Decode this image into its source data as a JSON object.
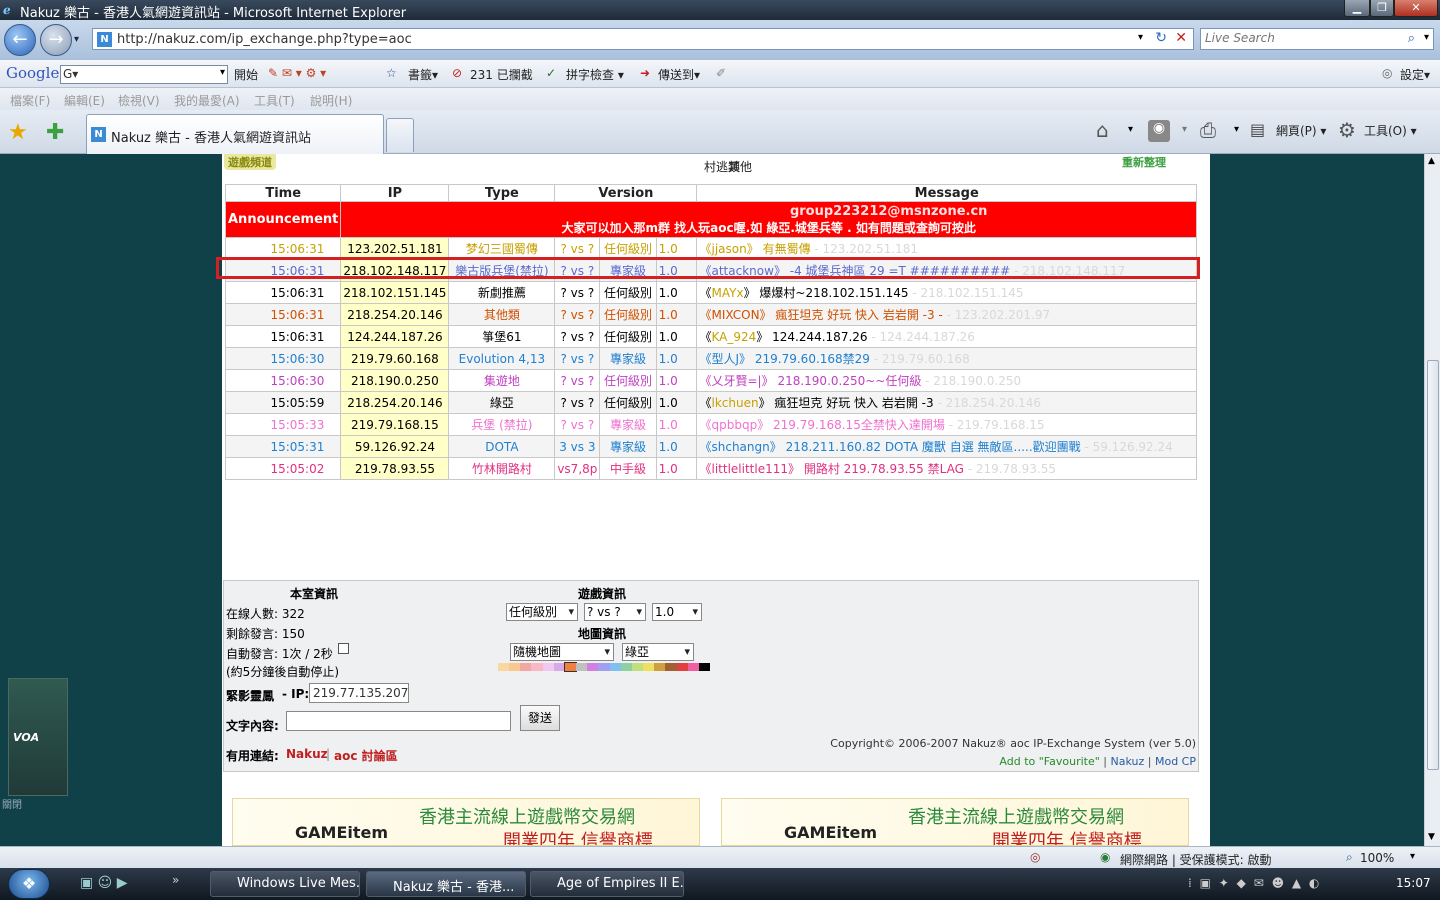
{
  "window": {
    "title": "Nakuz 樂古 - 香港人氣網遊資訊站 - Microsoft Internet Explorer"
  },
  "address": {
    "url": "http://nakuz.com/ip_exchange.php?type=aoc",
    "search_placeholder": "Live Search"
  },
  "googlebar": {
    "logo": "Google",
    "search_value": "G▾",
    "items": [
      "開始",
      "書籤▾",
      "231 已攔截",
      "拼字檢查 ▾",
      "傳送到▾"
    ],
    "settings": "設定▾"
  },
  "menu": [
    "檔案(F)",
    "編輯(E)",
    "檢視(V)",
    "我的最愛(A)",
    "工具(T)",
    "說明(H)"
  ],
  "tabs": {
    "active": "Nakuz 樂古 - 香港人氣網遊資訊站",
    "command": [
      "網頁(P) ▾",
      "工具(O) ▾"
    ]
  },
  "page": {
    "corner_left": "遊戲頻道",
    "corner_right": "重新整理",
    "categories": [
      "村逃類",
      "其他"
    ],
    "table": {
      "headers": [
        "Time",
        "IP",
        "Type",
        "Version",
        "Message"
      ],
      "announcement": {
        "label": "Announcement",
        "email": "group223212@msnzone.cn",
        "text": "大家可以加入那m群 找人玩aoc喔.如 綠亞.城堡兵等 . 如有問題或查詢可按此"
      },
      "rows": [
        {
          "time": "15:06:31",
          "ip": "123.202.51.181",
          "type": "梦幻三國蜀傳",
          "vs": "? vs ?",
          "level": "任何級別",
          "ver": "1.0",
          "user": "jjason",
          "msg": " 有無蜀傳",
          "ip2": " - 123.202.51.181",
          "color": "#c8a000"
        },
        {
          "time": "15:06:31",
          "ip": "218.102.148.117",
          "type": "樂古版兵堡(禁拉)",
          "vs": "? vs ?",
          "level": "專家級",
          "ver": "1.0",
          "user": "attacknow",
          "msg": " -4 城堡兵神區 29 =T ##########",
          "ip2": " - 218.102.148.117",
          "color": "#5a6ad0"
        },
        {
          "time": "15:06:31",
          "ip": "218.102.151.145",
          "type": "新劇推薦",
          "vs": "? vs ?",
          "level": "任何級別",
          "ver": "1.0",
          "user": "MAYx",
          "msg": " 爆爆村~218.102.151.145",
          "ip2": " - 218.102.151.145",
          "color": "#000000"
        },
        {
          "time": "15:06:31",
          "ip": "218.254.20.146",
          "type": "其他類",
          "vs": "? vs ?",
          "level": "任何級別",
          "ver": "1.0",
          "user": "MIXCON",
          "msg": " 瘋狂坦克 好玩 快入 岩岩開 -3 -",
          "ip2": " - 123.202.201.97",
          "color": "#d05000"
        },
        {
          "time": "15:06:31",
          "ip": "124.244.187.26",
          "type": "箏堡61",
          "vs": "? vs ?",
          "level": "任何級別",
          "ver": "1.0",
          "user": "KA_924",
          "msg": " 124.244.187.26",
          "ip2": " - 124.244.187.26",
          "color": "#000000"
        },
        {
          "time": "15:06:30",
          "ip": "219.79.60.168",
          "type": "Evolution 4,13",
          "vs": "? vs ?",
          "level": "專家級",
          "ver": "1.0",
          "user": "型人J",
          "msg": " 219.79.60.168禁29",
          "ip2": " - 219.79.60.168",
          "color": "#2080d0"
        },
        {
          "time": "15:06:30",
          "ip": "218.190.0.250",
          "type": "集遊地",
          "vs": "? vs ?",
          "level": "任何級別",
          "ver": "1.0",
          "user": "乂牙賢=|",
          "msg": " 218.190.0.250~~任何級",
          "ip2": " - 218.190.0.250",
          "color": "#c040c0"
        },
        {
          "time": "15:05:59",
          "ip": "218.254.20.146",
          "type": "綠亞",
          "vs": "? vs ?",
          "level": "任何級別",
          "ver": "1.0",
          "user": "lkchuen",
          "msg": " 瘋狂坦克 好玩 快入 岩岩開 -3",
          "ip2": " - 218.254.20.146",
          "color": "#000000"
        },
        {
          "time": "15:05:33",
          "ip": "219.79.168.15",
          "type": "兵堡 (禁拉)",
          "vs": "? vs ?",
          "level": "專家級",
          "ver": "1.0",
          "user": "qpbbqp",
          "msg": " 219.79.168.15全禁快入達開場",
          "ip2": " - 219.79.168.15",
          "color": "#f070d0"
        },
        {
          "time": "15:05:31",
          "ip": "59.126.92.24",
          "type": "DOTA",
          "vs": "3 vs 3",
          "level": "專家級",
          "ver": "1.0",
          "user": "shchangn",
          "msg": " 218.211.160.82 DOTA 魔獸 自選 無敵區.....歡迎團戰",
          "ip2": " - 59.126.92.24",
          "color": "#2080d0"
        },
        {
          "time": "15:05:02",
          "ip": "219.78.93.55",
          "type": "竹林開路村",
          "vs": "vs7,8p",
          "level": "中手級",
          "ver": "1.0",
          "user": "littlelittle111",
          "msg": " 開路村 219.78.93.55 禁LAG",
          "ip2": " - 219.78.93.55",
          "color": "#e03080"
        }
      ]
    },
    "room": {
      "heading": "本室資訊",
      "online": "在線人數: 322",
      "remaining": "剩餘發言: 150",
      "auto": "自動發言: 1次 / 2秒",
      "auto_note": "(約5分鐘後自動停止)",
      "ip_label": "緊影靈鳳",
      "ip_suffix": " - IP:",
      "ip_value": "219.77.135.207",
      "text_label": "文字內容:",
      "send": "發送",
      "links_label": "有用連結:",
      "link1": "Nakuz",
      "link2": "aoc 討論區"
    },
    "game": {
      "heading": "遊戲資訊",
      "level": "任何級別",
      "vs": "? vs ?",
      "ver": "1.0",
      "map_heading": "地圖資訊",
      "map": "隨機地圖",
      "map2": "綠亞"
    },
    "footer": {
      "copyright": "Copyright© 2006-2007  Nakuz® aoc IP-Exchange System (ver 5.0)",
      "fav": "Add to \"Favourite\"",
      "sep": "|",
      "nakuz": "Nakuz",
      "modcp": "Mod CP"
    },
    "banner": {
      "text1": "香港主流線上遊戲幣交易網",
      "text2": "開業四年 信譽商標",
      "logo": "GAMEitem"
    },
    "side_ad": "關閉"
  },
  "status": {
    "zone": "網際網路 | 受保護模式: 啟動",
    "zoom": "100%"
  },
  "taskbar": {
    "items": [
      "Windows Live Mes...",
      "Nakuz 樂古 - 香港...",
      "Age of Empires II E..."
    ],
    "time": "15:07"
  },
  "colors": {
    "announcement": "#ff0000",
    "highlight": "#d42020",
    "page_bg": "#104048"
  }
}
